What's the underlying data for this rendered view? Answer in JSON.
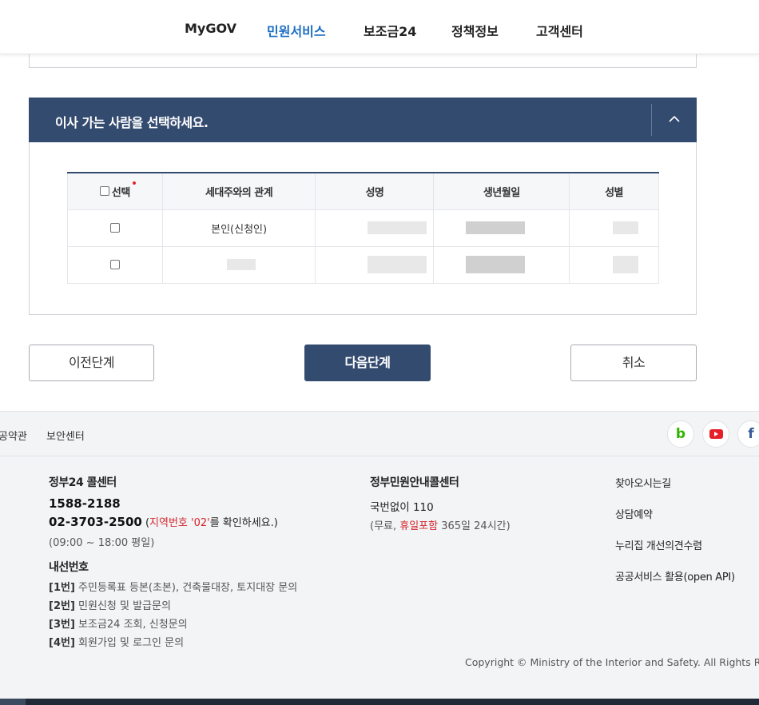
{
  "nav": {
    "items": [
      {
        "label": "MyGOV",
        "active": false
      },
      {
        "label": "민원서비스",
        "active": true
      },
      {
        "label": "보조금24",
        "active": false
      },
      {
        "label": "정책정보",
        "active": false
      },
      {
        "label": "고객센터",
        "active": false
      }
    ],
    "active_color": "#1a6ec2"
  },
  "panel": {
    "title": "이사 가는 사람을 선택하세요.",
    "header_color": "#344b70",
    "toggle_icon": "chevron-up-icon",
    "table": {
      "headers": [
        "선택",
        "세대주와의 관계",
        "성명",
        "생년월일",
        "성별"
      ],
      "rows": [
        {
          "relation": "본인(신청인)",
          "name": "",
          "birth": "",
          "gender": "",
          "checked": false
        },
        {
          "relation": "",
          "name": "",
          "birth": "",
          "gender": "",
          "checked": false
        }
      ]
    }
  },
  "buttons": {
    "prev": "이전단계",
    "next": "다음단계",
    "cancel": "취소"
  },
  "footer": {
    "links": [
      "공약관",
      "보안센터"
    ],
    "sns": [
      {
        "name": "blog-icon",
        "glyph": "b",
        "color": "#2db400"
      },
      {
        "name": "youtube-icon",
        "glyph": "▶",
        "color": "#e5202a"
      },
      {
        "name": "facebook-icon",
        "glyph": "f",
        "color": "#3b5998"
      }
    ],
    "callcenter": {
      "title": "정부24 콜센터",
      "phone1": "1588-2188",
      "phone2": "02-3703-2500",
      "phone2_note_open": "(",
      "phone2_note_red": "지역번호 '02'",
      "phone2_note_tail": "를 확인하세요.)",
      "hours": "(09:00 ~ 18:00 평일)",
      "ext_title": "내선번호",
      "ext": [
        {
          "num": "[1번]",
          "text": "주민등록표 등본(초본), 건축물대장, 토지대장 문의"
        },
        {
          "num": "[2번]",
          "text": "민원신청 및 발급문의"
        },
        {
          "num": "[3번]",
          "text": "보조금24 조회, 신청문의"
        },
        {
          "num": "[4번]",
          "text": "회원가입 및 로그인 문의"
        }
      ]
    },
    "civil": {
      "title": "정부민원안내콜센터",
      "line1": "국번없이 110",
      "line2_open": "(무료, ",
      "line2_red": "휴일포함",
      "line2_tail": " 365일 24시간)"
    },
    "menu": [
      "찾아오시는길",
      "상담예약",
      "누리집 개선의견수렴",
      "공공서비스 활용(open API)"
    ],
    "copyright": "Copyright © Ministry of the Interior and Safety. All Rights Rese"
  }
}
